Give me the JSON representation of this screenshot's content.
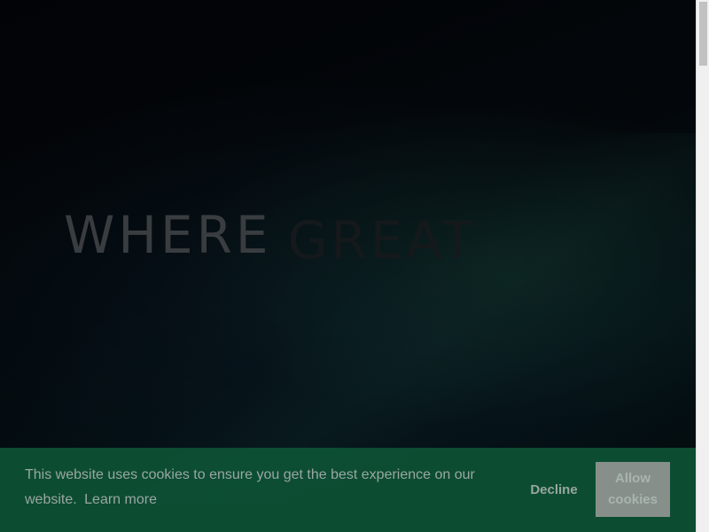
{
  "hero": {
    "word_1": "WHERE",
    "word_2": "GREAT"
  },
  "cookie_banner": {
    "message": "This website uses cookies to ensure you get the best experience on our website.",
    "learn_more": "Learn more",
    "decline_label": "Decline",
    "allow_label_line_1": "Allow",
    "allow_label_line_2": "cookies"
  },
  "colors": {
    "banner_background": "#0d5034",
    "allow_button_background": "#878f8b",
    "banner_text": "#9aa6a0"
  }
}
